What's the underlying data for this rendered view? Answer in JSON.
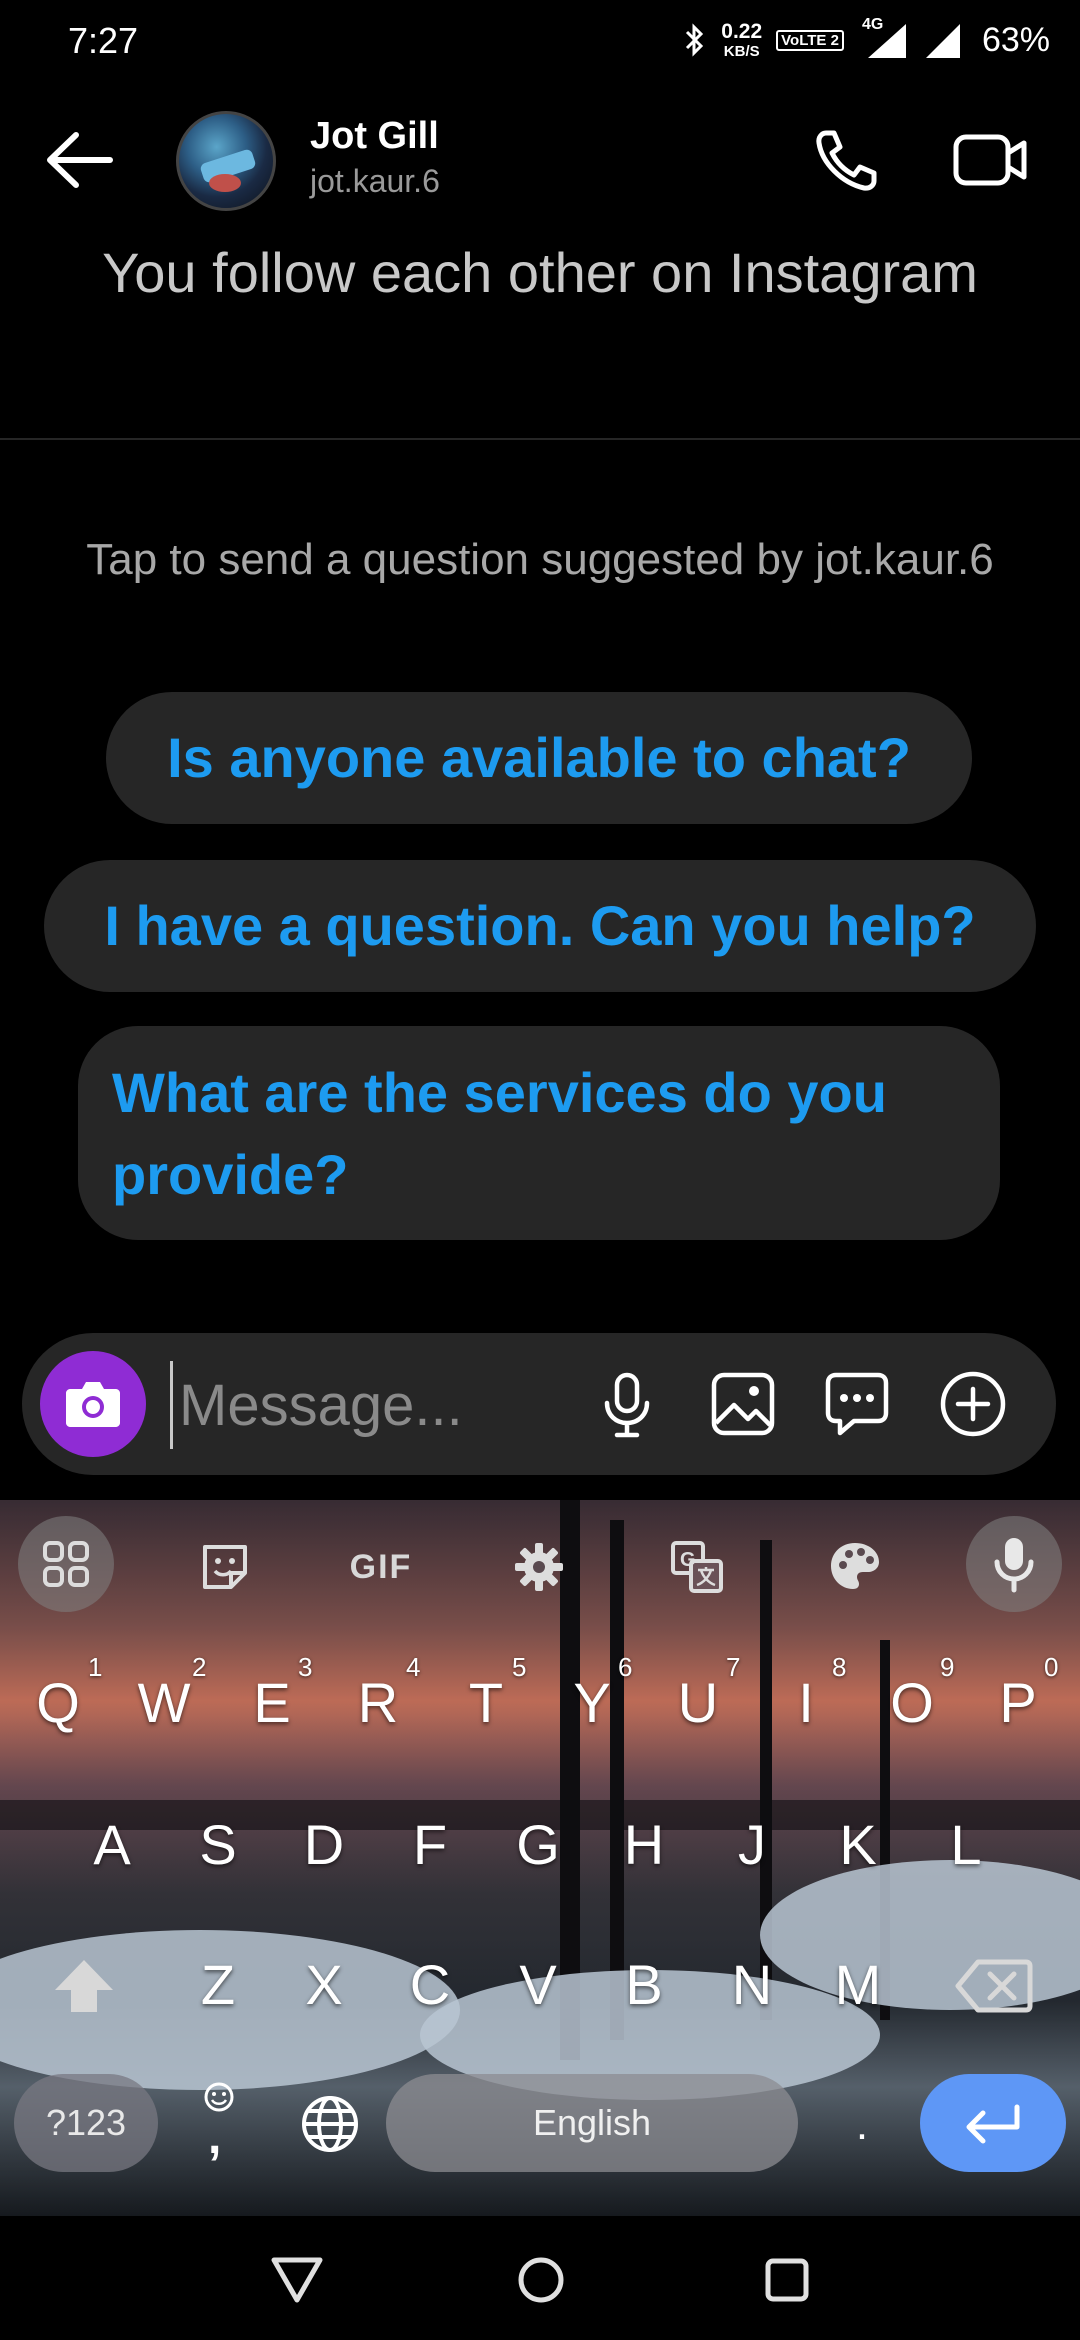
{
  "status_bar": {
    "time": "7:27",
    "speed_value": "0.22",
    "speed_unit": "KB/S",
    "volte": "VoLTE 2",
    "network": "4G",
    "battery": "63%"
  },
  "header": {
    "name": "Jot Gill",
    "handle": "jot.kaur.6"
  },
  "follow_note": "You follow each other on Instagram",
  "suggestions": {
    "caption": "Tap to send a question suggested by jot.kaur.6",
    "items": [
      "Is anyone available to chat?",
      "I have a question. Can you help?",
      "What are the services do you provide?"
    ]
  },
  "composer": {
    "placeholder": "Message..."
  },
  "keyboard": {
    "toolbar_gif": "GIF",
    "row1": [
      {
        "key": "Q",
        "num": "1"
      },
      {
        "key": "W",
        "num": "2"
      },
      {
        "key": "E",
        "num": "3"
      },
      {
        "key": "R",
        "num": "4"
      },
      {
        "key": "T",
        "num": "5"
      },
      {
        "key": "Y",
        "num": "6"
      },
      {
        "key": "U",
        "num": "7"
      },
      {
        "key": "I",
        "num": "8"
      },
      {
        "key": "O",
        "num": "9"
      },
      {
        "key": "P",
        "num": "0"
      }
    ],
    "row2": [
      "A",
      "S",
      "D",
      "F",
      "G",
      "H",
      "J",
      "K",
      "L"
    ],
    "row3": [
      "Z",
      "X",
      "C",
      "V",
      "B",
      "N",
      "M"
    ],
    "symbols_label": "?123",
    "comma": ",",
    "space_label": "English",
    "period": "."
  },
  "colors": {
    "accent_blue": "#1d9bf0",
    "camera_purple": "#8f2cd4",
    "enter_blue": "#5e97f6",
    "chip_bg": "#262626"
  }
}
